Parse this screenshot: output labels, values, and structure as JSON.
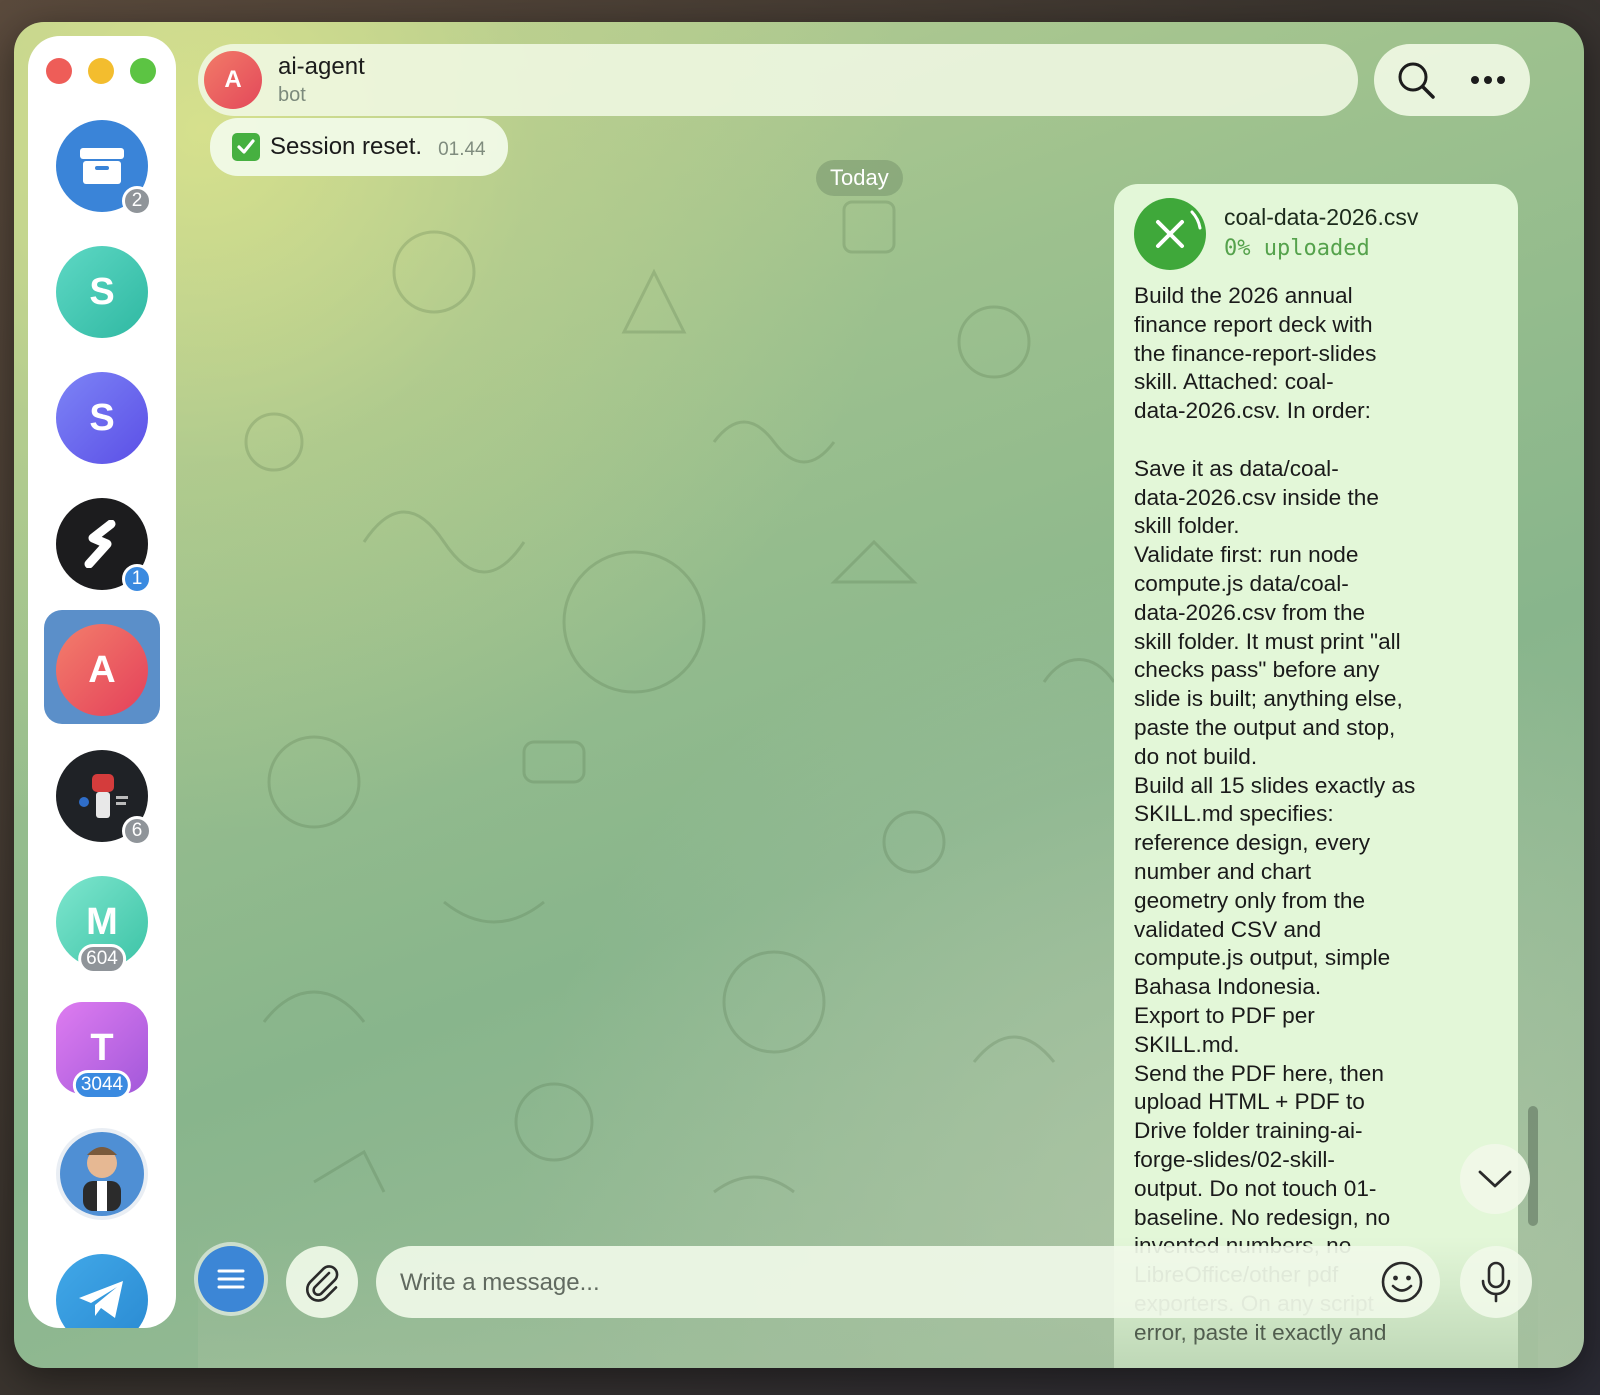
{
  "header": {
    "avatar_letter": "A",
    "name": "ai-agent",
    "subtitle": "bot",
    "search_icon": "search-icon",
    "more_icon": "more-icon"
  },
  "sidebar": {
    "chats": [
      {
        "icon": "archive-icon",
        "badge": "2"
      },
      {
        "letter": "S",
        "color": "#3fc6b0"
      },
      {
        "letter": "S",
        "color": "#6a6cf0"
      },
      {
        "icon": "s-logo-icon",
        "badge": "1"
      },
      {
        "letter": "A",
        "color": "#e8545d",
        "active": true
      },
      {
        "icon": "fist-logo-icon",
        "badge": "6"
      },
      {
        "letter": "M",
        "color": "#55d0b6",
        "badge": "604"
      },
      {
        "letter": "T",
        "color": "#c06adc",
        "badge": "3044"
      },
      {
        "icon": "cartoon-avatar-icon"
      },
      {
        "icon": "telegram-icon"
      }
    ]
  },
  "messages": {
    "incoming": {
      "text": "Session reset.",
      "time": "01.44"
    },
    "date_separator": "Today",
    "outgoing": {
      "file_name": "coal-data-2026.csv",
      "file_status": "0% uploaded",
      "lines": [
        "Build the 2026 annual",
        "finance report deck with",
        "the finance-report-slides",
        "skill. Attached: coal-",
        "data-2026.csv. In order:",
        "",
        "Save it as data/coal-",
        "data-2026.csv inside the",
        "skill folder.",
        "Validate first: run node",
        "compute.js data/coal-",
        "data-2026.csv from the",
        "skill folder. It must print \"all",
        "checks pass\" before any",
        "slide is built; anything else,",
        "paste the output and stop,",
        "do not build.",
        "Build all 15 slides exactly as",
        "SKILL.md specifies:",
        "reference design, every",
        "number and chart",
        "geometry only from the",
        "validated CSV and",
        "compute.js output, simple",
        "Bahasa Indonesia.",
        "Export to PDF per",
        "SKILL.md.",
        "Send the PDF here, then",
        "upload HTML + PDF to",
        "Drive folder training-ai-",
        "forge-slides/02-skill-",
        "output. Do not touch 01-",
        "baseline. No redesign, no",
        "invented numbers, no",
        "LibreOffice/other pdf",
        "exporters. On any script",
        "error, paste it exactly and"
      ]
    }
  },
  "composer": {
    "placeholder": "Write a message...",
    "menu_icon": "menu-icon",
    "attach_icon": "paperclip-icon",
    "emoji_icon": "emoji-icon",
    "mic_icon": "microphone-icon"
  },
  "colors": {
    "accent": "#3c86d6",
    "outgoing_bubble": "#e3f7d8",
    "upload_green": "#3fa83a"
  }
}
